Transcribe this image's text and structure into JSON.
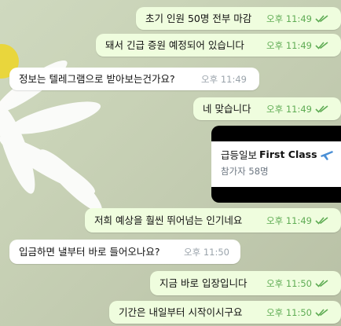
{
  "messages": [
    {
      "text": "초기 인원 50명 전부 마감",
      "time": "오후 11:49"
    },
    {
      "text": "돼서 긴급 증원 예정되어 있습니다",
      "time": "오후 11:49"
    },
    {
      "text": "정보는 텔레그램으로 받아보는건가요?",
      "time": "오후 11:49"
    },
    {
      "text": "네 맞습니다",
      "time": "오후 11:49"
    },
    {
      "text": "저희 예상을 훨씬 뛰어넘는 인기네요",
      "time": "오후 11:49"
    },
    {
      "text": "입금하면 낼부터 바로 들어오나요?",
      "time": "오후 11:50"
    },
    {
      "text": "지금 바로 입장입니다",
      "time": "오후 11:50"
    },
    {
      "text": "기간은 내일부터 시작이시구요",
      "time": "오후 11:50"
    }
  ],
  "channel_card": {
    "name_prefix": "급등일보",
    "name_bold": "First Class",
    "members": "참가자 58명"
  },
  "colors": {
    "outgoing_bubble": "#effdde",
    "incoming_bubble": "#ffffff",
    "read_tick": "#5fac54"
  },
  "icons": {
    "read_status": "double-check-icon",
    "card_emoji": "airplane-icon"
  }
}
